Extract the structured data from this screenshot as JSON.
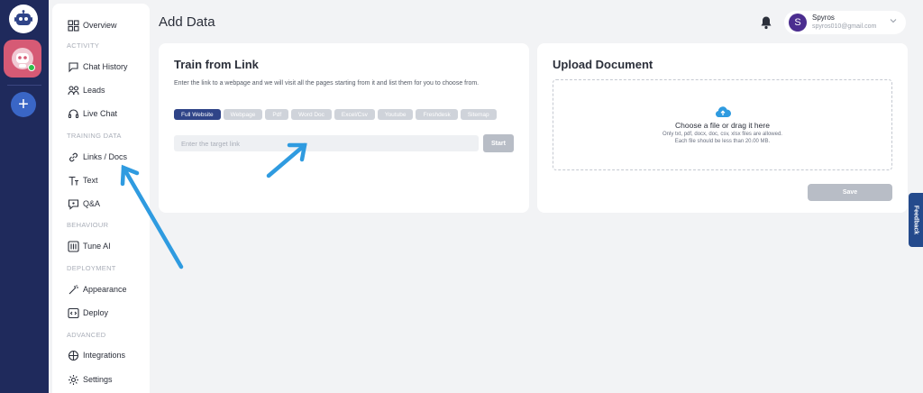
{
  "header": {
    "title": "Add Data"
  },
  "user": {
    "initial": "S",
    "name": "Spyros",
    "email": "spyros010@gmail.com"
  },
  "sidebar": {
    "overview": "Overview",
    "sections": {
      "activity": "ACTIVITY",
      "training": "TRAINING DATA",
      "behaviour": "BEHAVIOUR",
      "deployment": "DEPLOYMENT",
      "advanced": "ADVANCED"
    },
    "items": {
      "chat_history": "Chat History",
      "leads": "Leads",
      "live_chat": "Live Chat",
      "links_docs": "Links / Docs",
      "text": "Text",
      "qa": "Q&A",
      "tune_ai": "Tune AI",
      "appearance": "Appearance",
      "deploy": "Deploy",
      "integrations": "Integrations",
      "settings": "Settings"
    }
  },
  "train_link": {
    "title": "Train from Link",
    "description": "Enter the link to a webpage and we will visit all the pages starting from it and list them for you to choose from.",
    "chips": [
      "Full Website",
      "Webpage",
      "Pdf",
      "Word Doc",
      "Excel/Csv",
      "Youtube",
      "Freshdesk",
      "Sitemap"
    ],
    "placeholder": "Enter the target link",
    "start": "Start"
  },
  "upload": {
    "title": "Upload Document",
    "drop_title": "Choose a file or drag it here",
    "allowed": "Only txt, pdf, docx, doc, csv, xlsx files are allowed.",
    "size_limit": "Each file should be less than 20.00 MB.",
    "save": "Save"
  },
  "feedback": "Feedback",
  "colors": {
    "rail": "#1f2a5c",
    "accent": "#2f4488",
    "arrow": "#2f9be0",
    "disabled": "#b8bdc6"
  }
}
